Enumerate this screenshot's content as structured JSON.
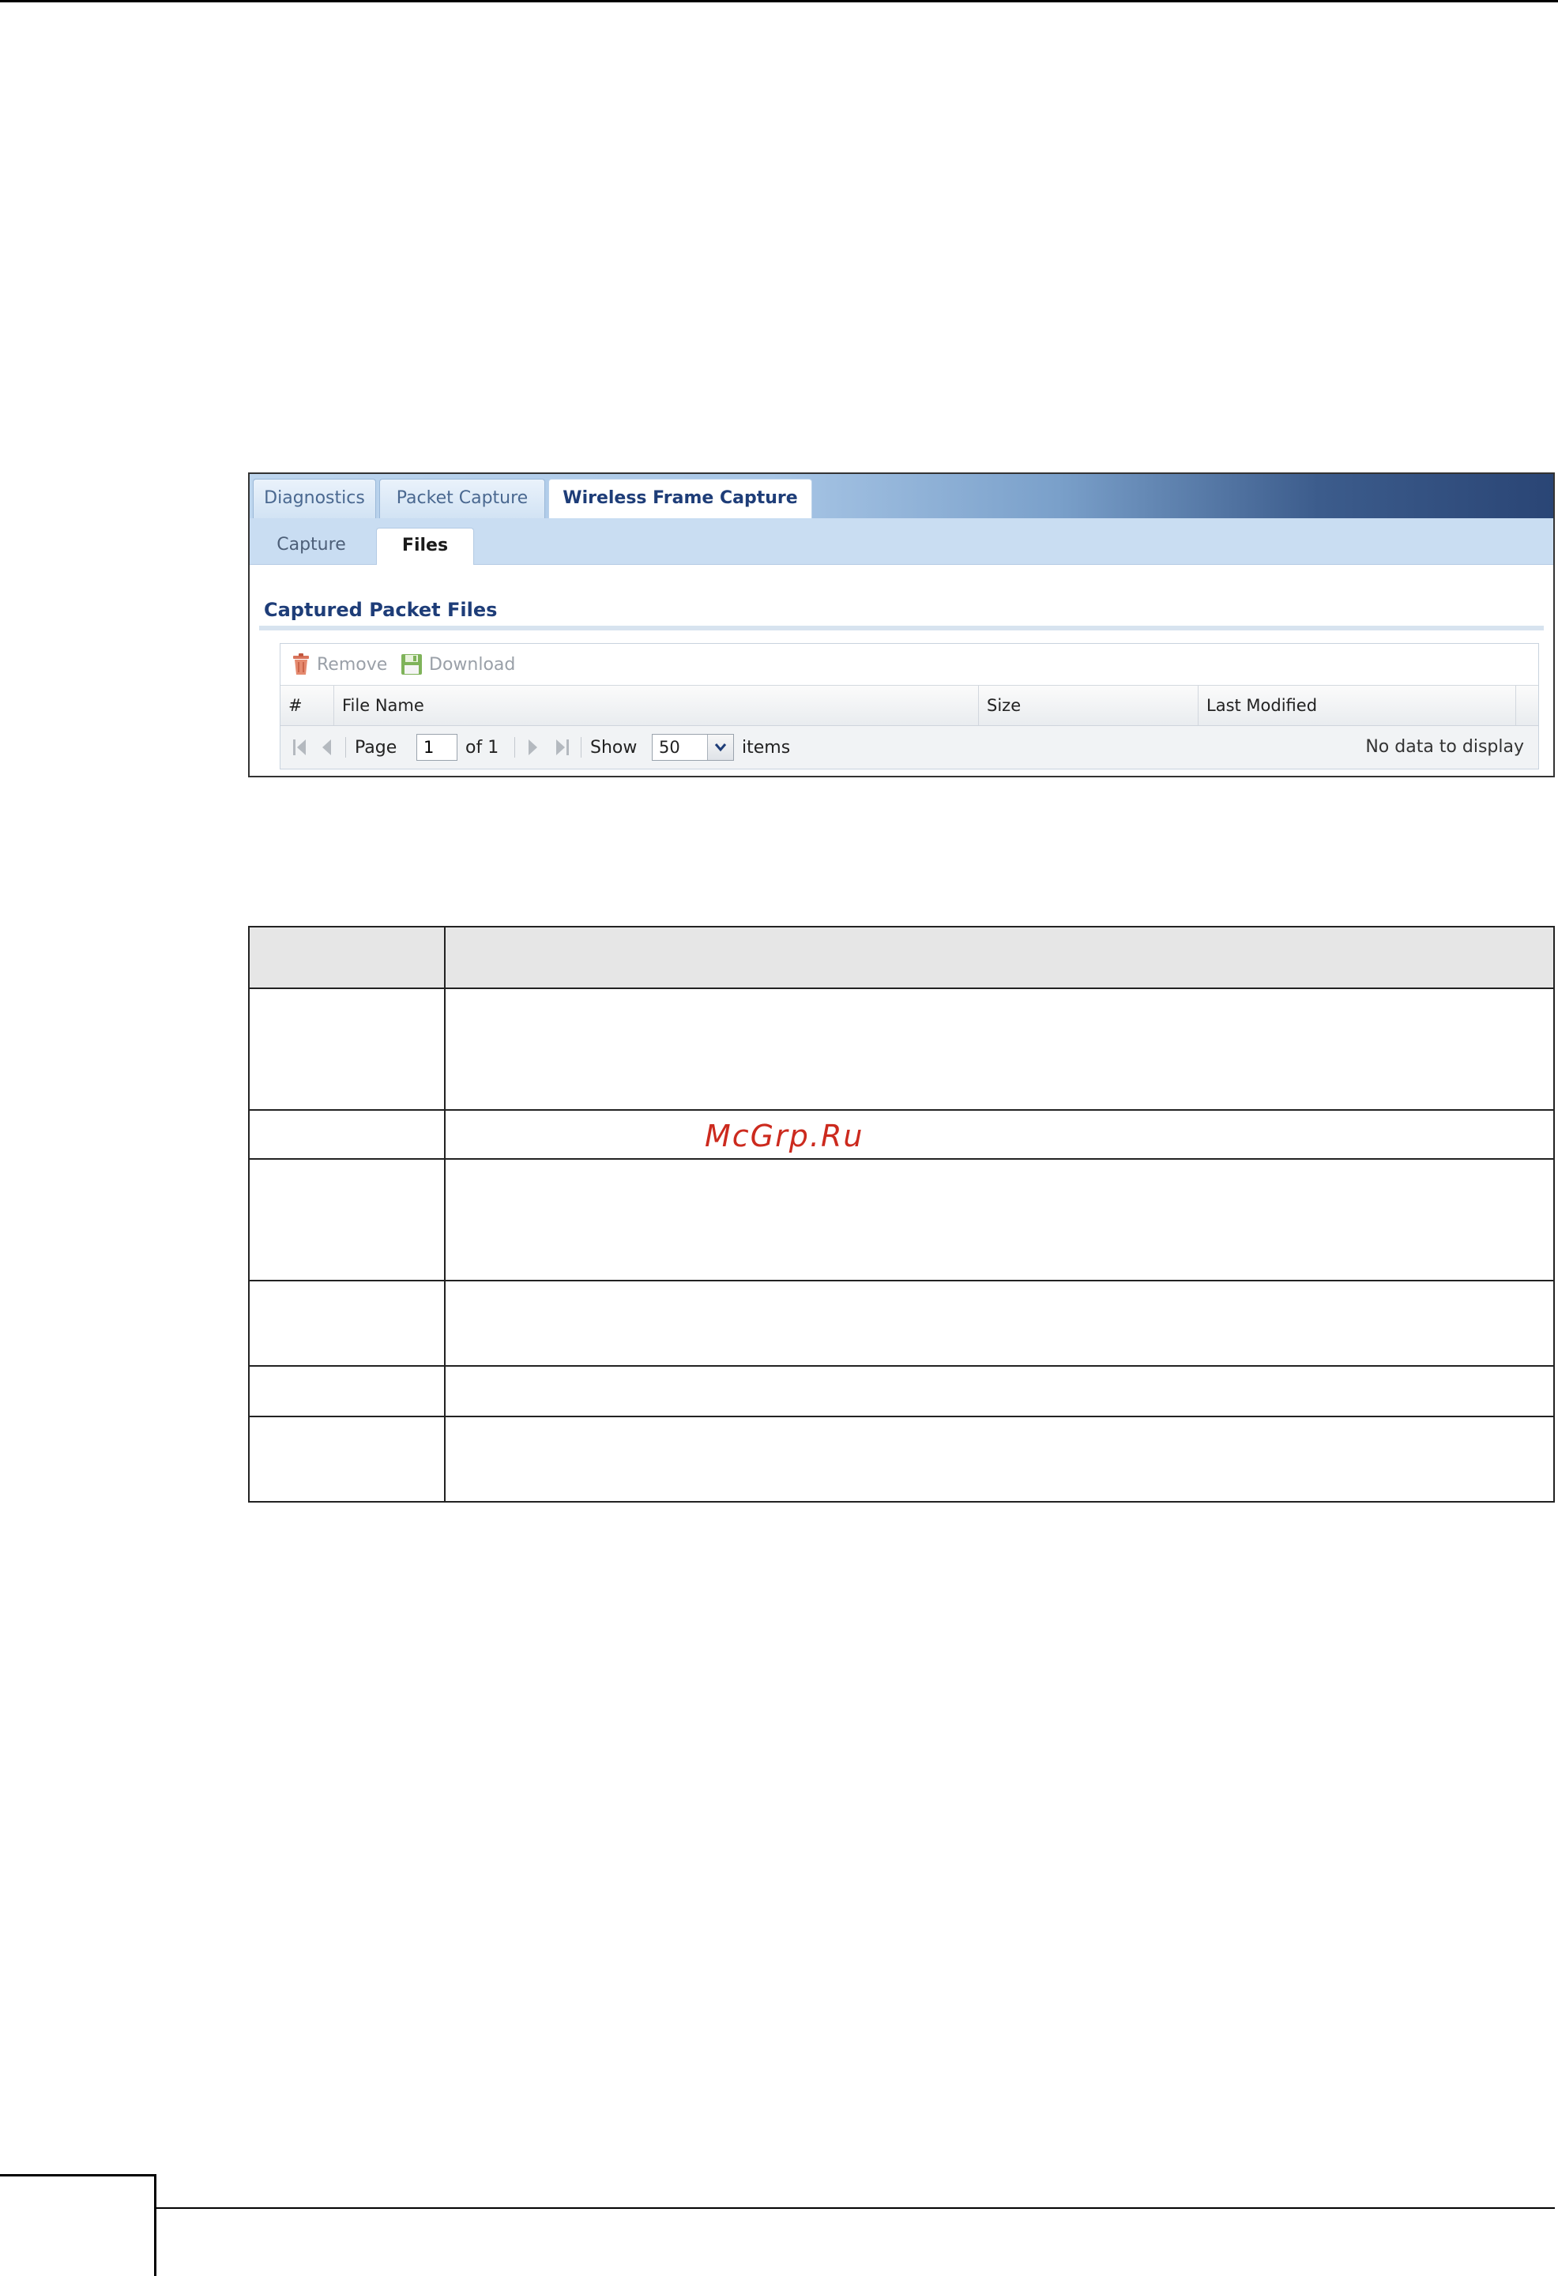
{
  "main_tabs": [
    "Diagnostics",
    "Packet Capture",
    "Wireless Frame Capture"
  ],
  "active_main_tab": "Wireless Frame Capture",
  "sub_tabs": [
    "Capture",
    "Files"
  ],
  "active_sub_tab": "Files",
  "section_title": "Captured Packet Files",
  "toolbar": {
    "remove_label": "Remove",
    "download_label": "Download"
  },
  "grid": {
    "columns": [
      "#",
      "File Name",
      "Size",
      "Last Modified"
    ],
    "rows": []
  },
  "pager": {
    "page_label": "Page",
    "page_value": "1",
    "of_label": "of 1",
    "show_label": "Show",
    "show_value": "50",
    "items_label": "items",
    "empty_message": "No data to display"
  },
  "watermark": "McGrp.Ru",
  "colors": {
    "tab_text": "#4a6890",
    "title_blue": "#1e3d78",
    "watermark_red": "#cc2a1e"
  }
}
